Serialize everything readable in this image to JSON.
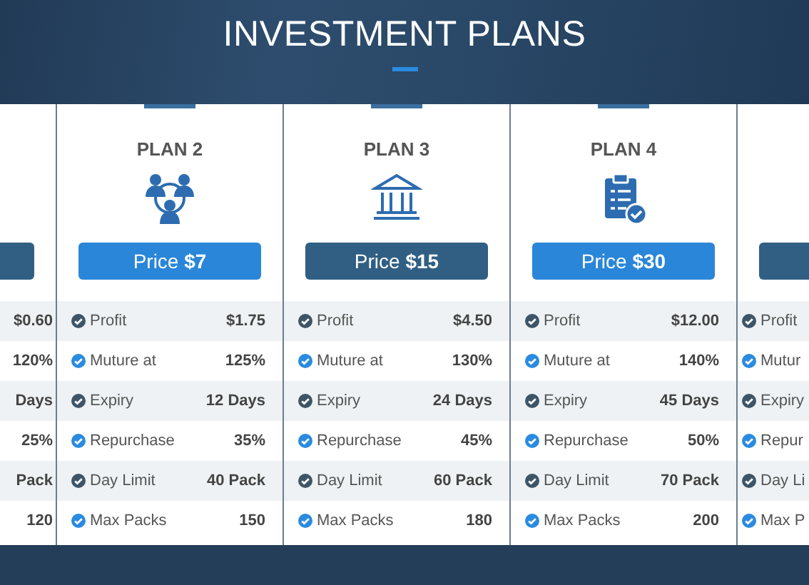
{
  "header": {
    "title": "INVESTMENT PLANS"
  },
  "plans": [
    {
      "kind": "clipped_left",
      "highlighted": false,
      "rows": [
        {
          "value": "$0.60"
        },
        {
          "value": "120%"
        },
        {
          "value": "Days"
        },
        {
          "value": "25%"
        },
        {
          "value": "Pack"
        },
        {
          "value": "120"
        }
      ]
    },
    {
      "kind": "full",
      "title": "PLAN 2",
      "price": "Price **$7**",
      "highlighted": true,
      "rows": [
        {
          "label": "Profit",
          "value": "$1.75"
        },
        {
          "label": "Muture at",
          "value": "125%"
        },
        {
          "label": "Expiry",
          "value": "12 Days"
        },
        {
          "label": "Repurchase",
          "value": "35%"
        },
        {
          "label": "Day Limit",
          "value": "40 Pack"
        },
        {
          "label": "Max Packs",
          "value": "150"
        }
      ]
    },
    {
      "kind": "full",
      "title": "PLAN 3",
      "price": "Price **$15**",
      "highlighted": false,
      "rows": [
        {
          "label": "Profit",
          "value": "$4.50"
        },
        {
          "label": "Muture at",
          "value": "130%"
        },
        {
          "label": "Expiry",
          "value": "24 Days"
        },
        {
          "label": "Repurchase",
          "value": "45%"
        },
        {
          "label": "Day Limit",
          "value": "60 Pack"
        },
        {
          "label": "Max Packs",
          "value": "180"
        }
      ]
    },
    {
      "kind": "full",
      "title": "PLAN 4",
      "price": "Price **$30**",
      "highlighted": true,
      "rows": [
        {
          "label": "Profit",
          "value": "$12.00"
        },
        {
          "label": "Muture at",
          "value": "140%"
        },
        {
          "label": "Expiry",
          "value": "45 Days"
        },
        {
          "label": "Repurchase",
          "value": "50%"
        },
        {
          "label": "Day Limit",
          "value": "70 Pack"
        },
        {
          "label": "Max Packs",
          "value": "200"
        }
      ]
    },
    {
      "kind": "clipped_right",
      "highlighted": false,
      "rows": [
        {
          "label": "Profit"
        },
        {
          "label": "Mutur"
        },
        {
          "label": "Expiry"
        },
        {
          "label": "Repur"
        },
        {
          "label": "Day Li"
        },
        {
          "label": "Max P"
        }
      ]
    }
  ]
}
